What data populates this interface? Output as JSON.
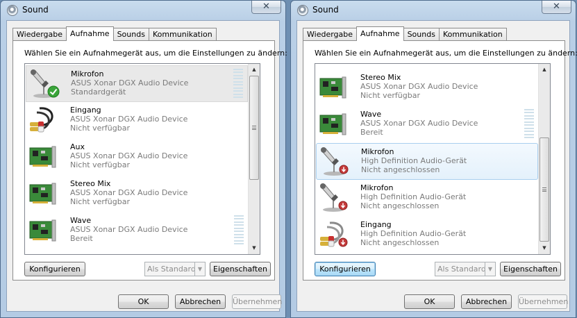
{
  "window_title": "Sound",
  "tabs": [
    "Wiedergabe",
    "Aufnahme",
    "Sounds",
    "Kommunikation"
  ],
  "instruction": "Wählen Sie ein Aufnahmegerät aus, um die Einstellungen zu ändern:",
  "left": {
    "devices": [
      {
        "name": "Mikrofon",
        "device": "ASUS Xonar DGX Audio Device",
        "status": "Standardgerät",
        "icon": "microphone-icon",
        "badge": "default-checkmark"
      },
      {
        "name": "Eingang",
        "device": "ASUS Xonar DGX Audio Device",
        "status": "Nicht verfügbar",
        "icon": "rca-cable-icon"
      },
      {
        "name": "Aux",
        "device": "ASUS Xonar DGX Audio Device",
        "status": "Nicht verfügbar",
        "icon": "soundcard-icon"
      },
      {
        "name": "Stereo Mix",
        "device": "ASUS Xonar DGX Audio Device",
        "status": "Nicht verfügbar",
        "icon": "soundcard-icon"
      },
      {
        "name": "Wave",
        "device": "ASUS Xonar DGX Audio Device",
        "status": "Bereit",
        "icon": "soundcard-icon"
      }
    ]
  },
  "right": {
    "devices": [
      {
        "name": "Stereo Mix",
        "device": "ASUS Xonar DGX Audio Device",
        "status": "Nicht verfügbar",
        "icon": "soundcard-icon"
      },
      {
        "name": "Wave",
        "device": "ASUS Xonar DGX Audio Device",
        "status": "Bereit",
        "icon": "soundcard-icon"
      },
      {
        "name": "Mikrofon",
        "device": "High Definition Audio-Gerät",
        "status": "Nicht angeschlossen",
        "icon": "microphone-icon",
        "badge": "unplugged"
      },
      {
        "name": "Mikrofon",
        "device": "High Definition Audio-Gerät",
        "status": "Nicht angeschlossen",
        "icon": "microphone-icon",
        "badge": "unplugged"
      },
      {
        "name": "Eingang",
        "device": "High Definition Audio-Gerät",
        "status": "Nicht angeschlossen",
        "icon": "rca-cable-icon",
        "badge": "unplugged"
      }
    ]
  },
  "buttons": {
    "configure": "Konfigurieren",
    "set_default": "Als Standard",
    "properties": "Eigenschaften",
    "ok": "OK",
    "cancel": "Abbrechen",
    "apply": "Übernehmen",
    "close_glyph": "✕"
  },
  "colors": {
    "selection_blue": "#e4f1fb",
    "selection_gray": "#e9e9e9"
  }
}
